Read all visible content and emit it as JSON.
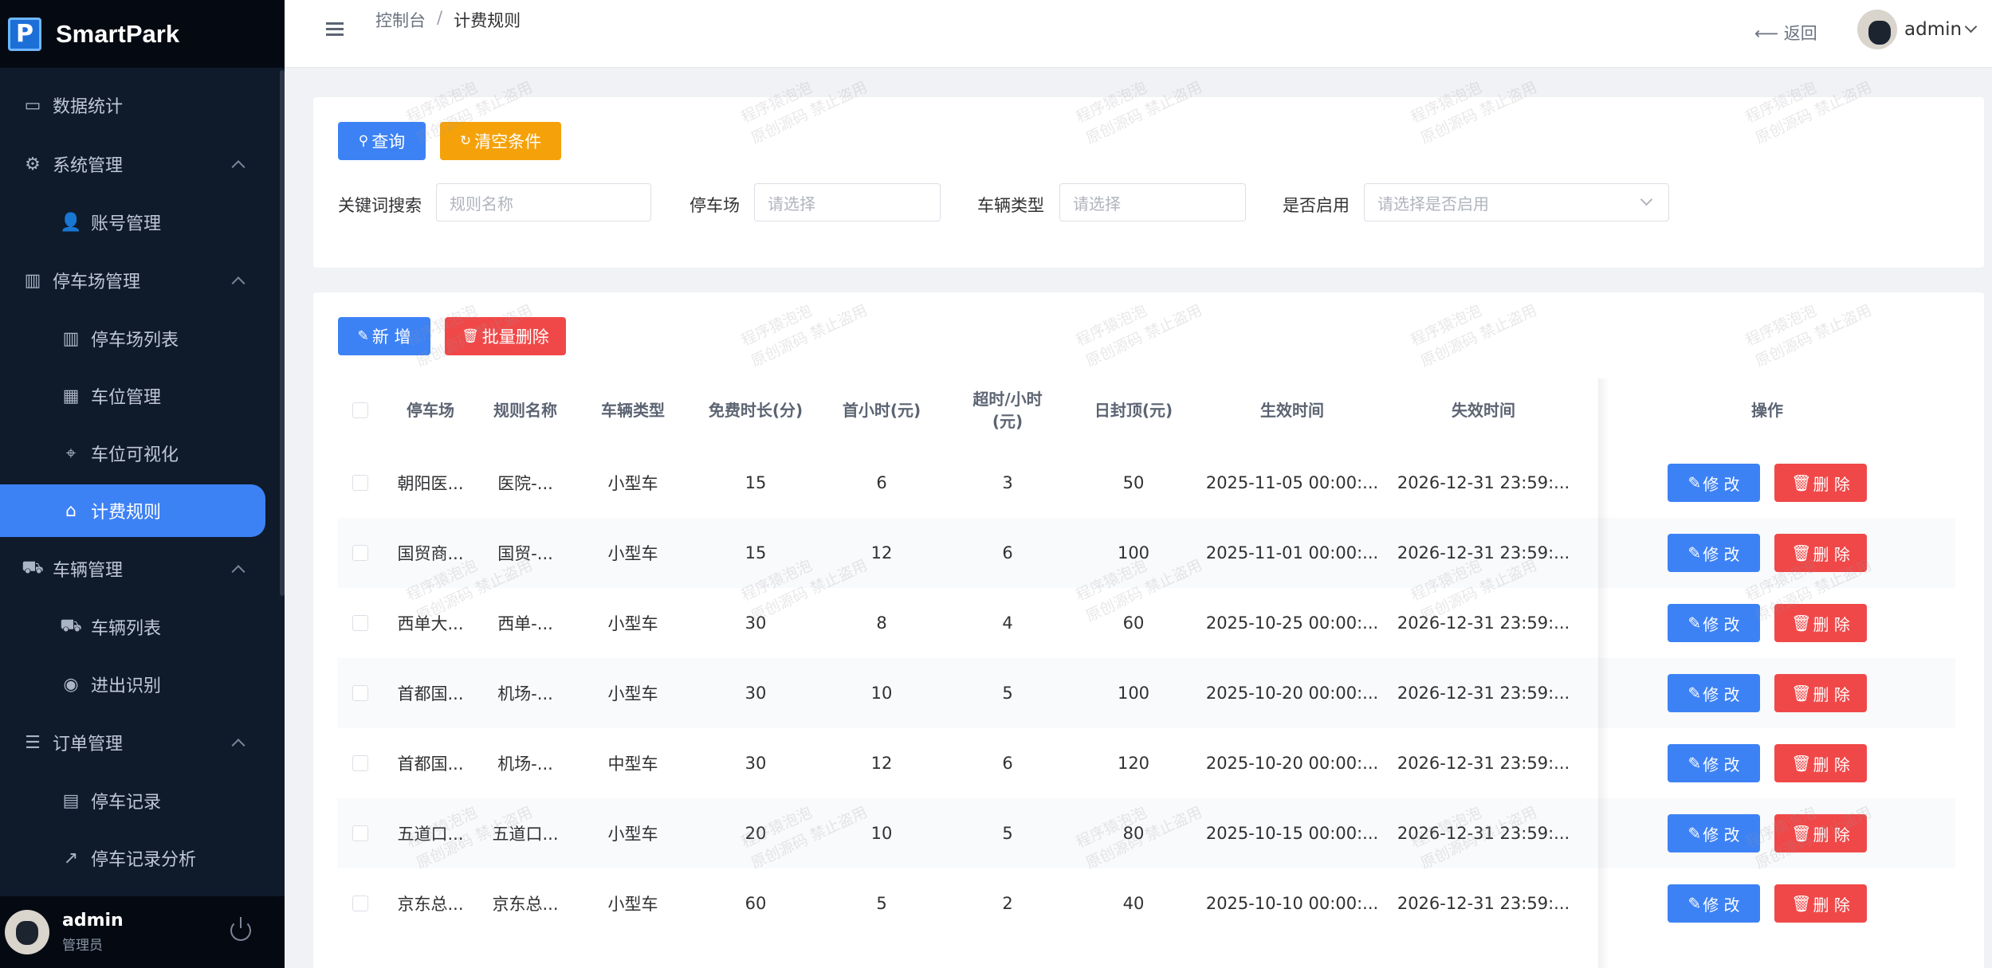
{
  "app": {
    "name": "SmartPark",
    "logo_letter": "P"
  },
  "sidebar": {
    "items": [
      {
        "label": "数据统计",
        "icon": "chart-icon",
        "level": 1
      },
      {
        "label": "系统管理",
        "icon": "gear-icon",
        "level": 1,
        "expanded": true
      },
      {
        "label": "账号管理",
        "icon": "user-icon",
        "level": 2
      },
      {
        "label": "停车场管理",
        "icon": "building-icon",
        "level": 1,
        "expanded": true
      },
      {
        "label": "停车场列表",
        "icon": "building-icon",
        "level": 2
      },
      {
        "label": "车位管理",
        "icon": "grid-icon",
        "level": 2
      },
      {
        "label": "车位可视化",
        "icon": "location-icon",
        "level": 2
      },
      {
        "label": "计费规则",
        "icon": "tag-icon",
        "level": 2,
        "active": true
      },
      {
        "label": "车辆管理",
        "icon": "truck-icon",
        "level": 1,
        "expanded": true
      },
      {
        "label": "车辆列表",
        "icon": "truck-icon",
        "level": 2
      },
      {
        "label": "进出识别",
        "icon": "camera-icon",
        "level": 2
      },
      {
        "label": "订单管理",
        "icon": "list-icon",
        "level": 1,
        "expanded": true
      },
      {
        "label": "停车记录",
        "icon": "document-icon",
        "level": 2
      },
      {
        "label": "停车记录分析",
        "icon": "trend-icon",
        "level": 2
      }
    ],
    "user": {
      "name": "admin",
      "role": "管理员"
    }
  },
  "header": {
    "breadcrumb_home": "控制台",
    "breadcrumb_sep": "/",
    "breadcrumb_current": "计费规则",
    "back_label": "返回",
    "user_name": "admin"
  },
  "search": {
    "query_label": "查询",
    "clear_label": "清空条件",
    "keyword_label": "关键词搜索",
    "keyword_placeholder": "规则名称",
    "lot_label": "停车场",
    "lot_placeholder": "请选择",
    "vehicle_label": "车辆类型",
    "vehicle_placeholder": "请选择",
    "enabled_label": "是否启用",
    "enabled_placeholder": "请选择是否启用"
  },
  "toolbar": {
    "add_label": "新 增",
    "batch_delete_label": "批量删除"
  },
  "table": {
    "columns": [
      "停车场",
      "规则名称",
      "车辆类型",
      "免费时长(分)",
      "首小时(元)",
      "超时/小时(元)",
      "日封顶(元)",
      "生效时间",
      "失效时间",
      "操作"
    ],
    "edit_label": "修 改",
    "delete_label": "删 除",
    "rows": [
      [
        "朝阳医...",
        "医院-...",
        "小型车",
        "15",
        "6",
        "3",
        "50",
        "2025-11-05 00:00:...",
        "2026-12-31 23:59:..."
      ],
      [
        "国贸商...",
        "国贸-...",
        "小型车",
        "15",
        "12",
        "6",
        "100",
        "2025-11-01 00:00:...",
        "2026-12-31 23:59:..."
      ],
      [
        "西单大...",
        "西单-...",
        "小型车",
        "30",
        "8",
        "4",
        "60",
        "2025-10-25 00:00:...",
        "2026-12-31 23:59:..."
      ],
      [
        "首都国...",
        "机场-...",
        "小型车",
        "30",
        "10",
        "5",
        "100",
        "2025-10-20 00:00:...",
        "2026-12-31 23:59:..."
      ],
      [
        "首都国...",
        "机场-...",
        "中型车",
        "30",
        "12",
        "6",
        "120",
        "2025-10-20 00:00:...",
        "2026-12-31 23:59:..."
      ],
      [
        "五道口...",
        "五道口...",
        "小型车",
        "20",
        "10",
        "5",
        "80",
        "2025-10-15 00:00:...",
        "2026-12-31 23:59:..."
      ],
      [
        "京东总...",
        "京东总...",
        "小型车",
        "60",
        "5",
        "2",
        "40",
        "2025-10-10 00:00:...",
        "2026-12-31 23:59:..."
      ]
    ]
  },
  "watermark": {
    "line1": "程序猿泡泡",
    "line2": "原创源码 禁止盗用"
  }
}
